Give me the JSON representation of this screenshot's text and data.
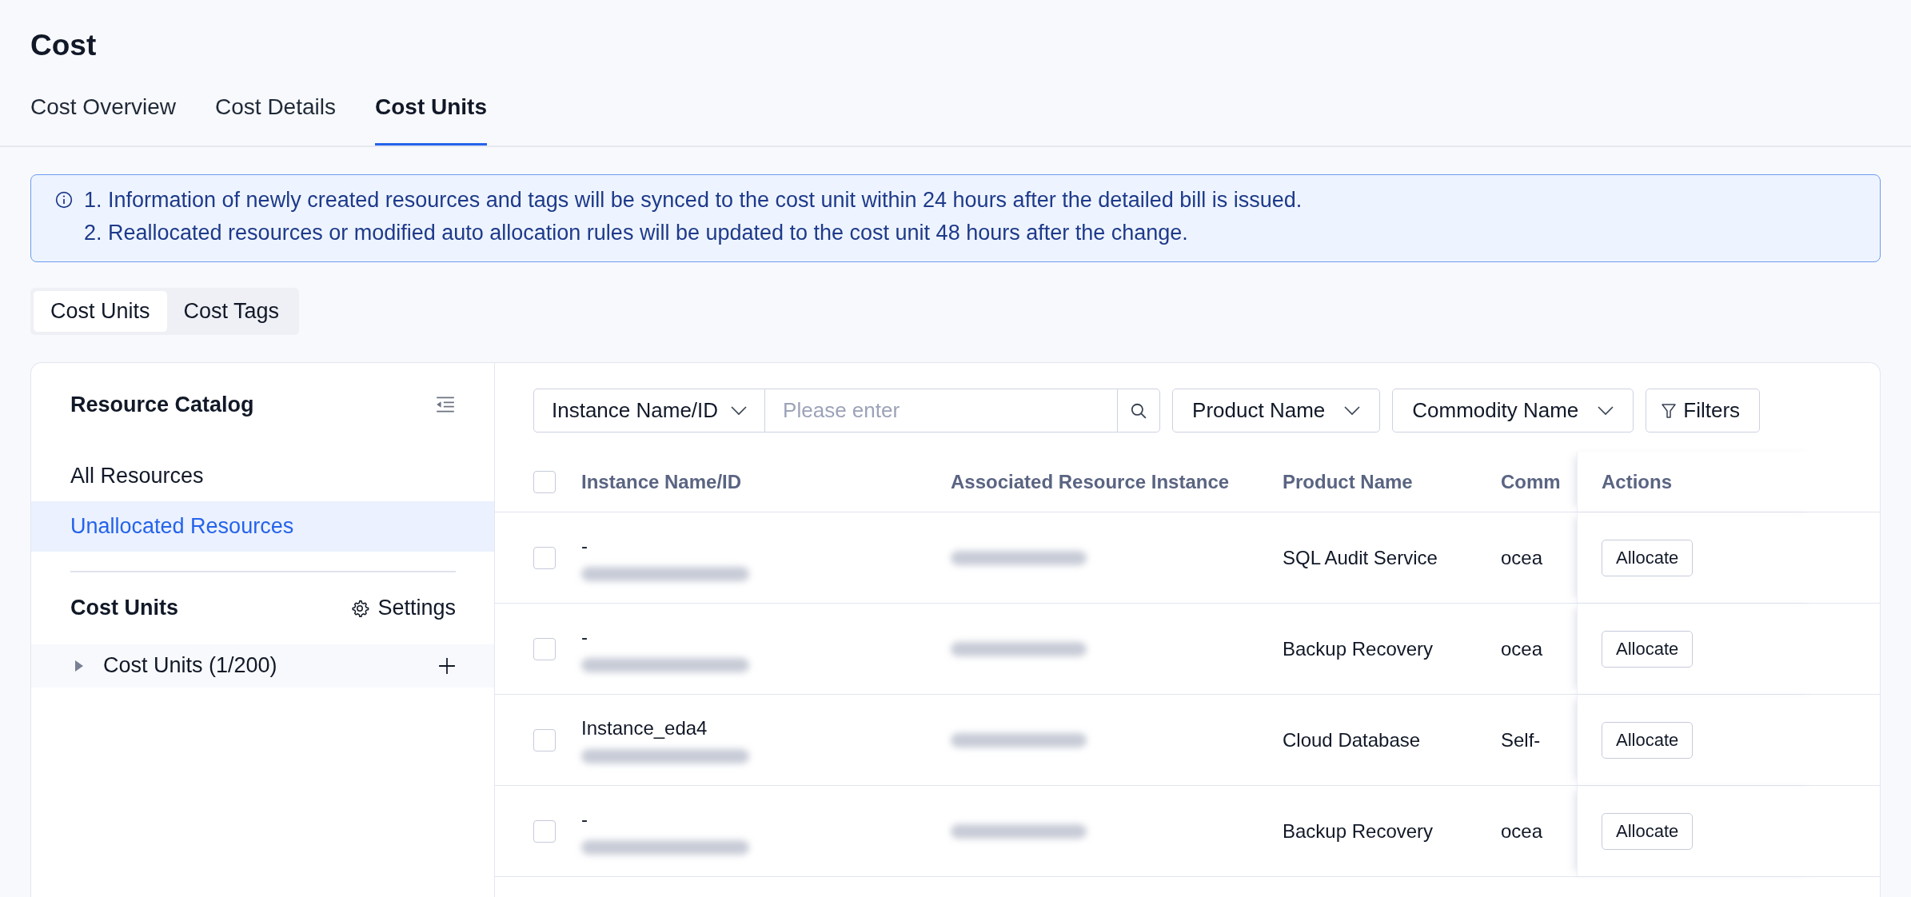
{
  "page": {
    "title": "Cost"
  },
  "tabs": [
    {
      "label": "Cost Overview",
      "selected": false
    },
    {
      "label": "Cost Details",
      "selected": false
    },
    {
      "label": "Cost Units",
      "selected": true
    }
  ],
  "notice": {
    "lines": [
      "1. Information of newly created resources and tags will be synced to the cost unit within 24 hours after the detailed bill is issued.",
      "2. Reallocated resources or modified auto allocation rules will be updated to the cost unit 48 hours after the change."
    ]
  },
  "segments": [
    {
      "label": "Cost Units",
      "selected": true
    },
    {
      "label": "Cost Tags",
      "selected": false
    }
  ],
  "sidebar": {
    "title": "Resource Catalog",
    "items": [
      {
        "label": "All Resources",
        "selected": false
      },
      {
        "label": "Unallocated Resources",
        "selected": true
      }
    ],
    "cost_units": {
      "title": "Cost Units",
      "settings": "Settings",
      "tree": [
        {
          "label": "Cost Units (1/200)",
          "expanded": false
        }
      ]
    }
  },
  "toolbar": {
    "search_type": "Instance Name/ID",
    "placeholder": "Please enter",
    "filters": [
      "Product Name",
      "Commodity Name"
    ],
    "filters_button": "Filters"
  },
  "table": {
    "all_checked": false,
    "columns": [
      "Instance Name/ID",
      "Associated Resource Instance",
      "Product Name",
      "Comm",
      "Actions"
    ],
    "rows": [
      {
        "checked": false,
        "name": "-",
        "product": "SQL Audit Service",
        "commodity": "ocea",
        "action": "Allocate"
      },
      {
        "checked": false,
        "name": "-",
        "product": "Backup Recovery",
        "commodity": "ocea",
        "action": "Allocate"
      },
      {
        "checked": false,
        "name": "Instance_eda4",
        "product": "Cloud Database",
        "commodity": "Self-",
        "action": "Allocate"
      },
      {
        "checked": false,
        "name": "-",
        "product": "Backup Recovery",
        "commodity": "ocea",
        "action": "Allocate"
      }
    ]
  }
}
